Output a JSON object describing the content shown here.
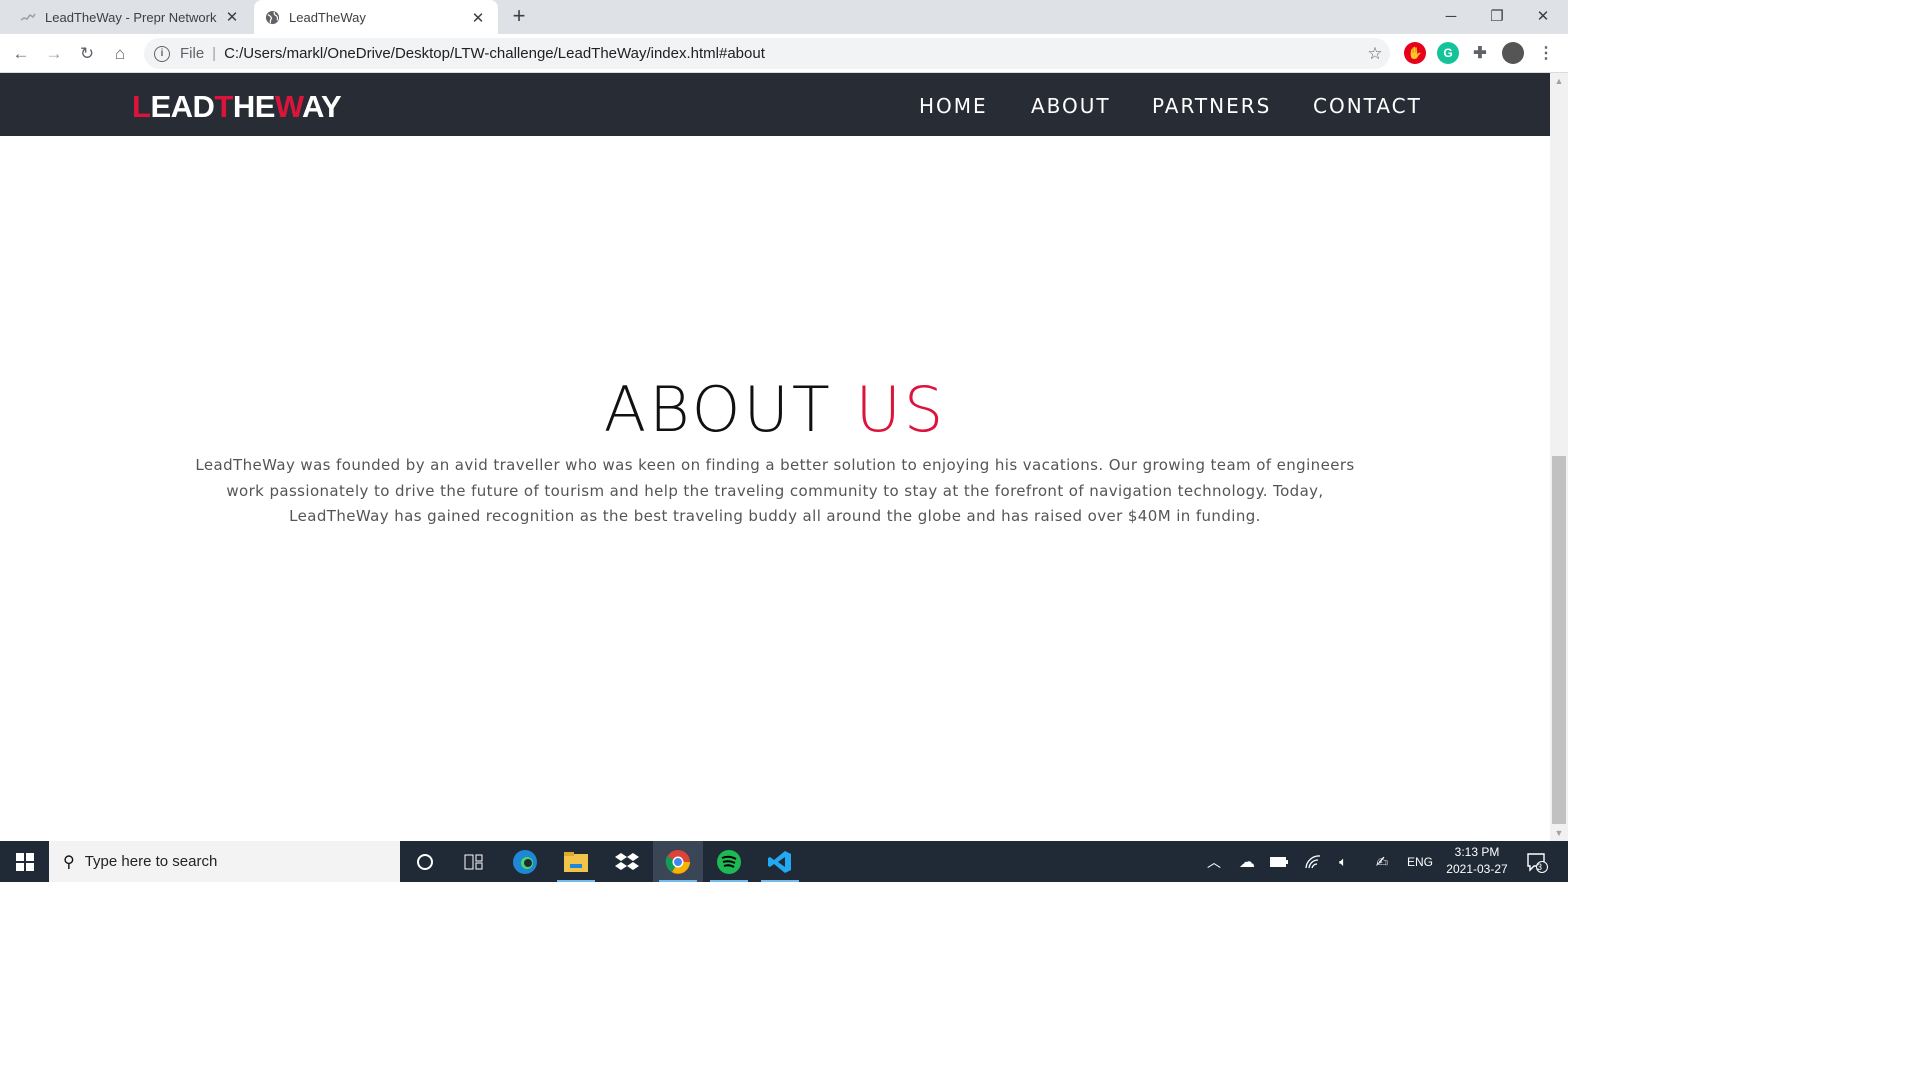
{
  "browser": {
    "tabs": [
      {
        "title": "LeadTheWay - Prepr Network",
        "active": false
      },
      {
        "title": "LeadTheWay",
        "active": true
      }
    ],
    "new_tab": "+",
    "address": {
      "scheme": "File",
      "url": "C:/Users/markl/OneDrive/Desktop/LTW-challenge/LeadTheWay/index.html#about"
    }
  },
  "site": {
    "logo": {
      "l": "L",
      "ead": "EAD",
      "t": "T",
      "he": "HE",
      "w": "W",
      "ay": "AY"
    },
    "nav": [
      "HOME",
      "ABOUT",
      "PARTNERS",
      "CONTACT"
    ],
    "about": {
      "title_main": "ABOUT",
      "title_accent": "US",
      "text": "LeadTheWay was founded by an avid traveller who was keen on finding a better solution to enjoying his vacations. Our growing team of engineers work passionately to drive the future of tourism and help the traveling community to stay at the forefront of navigation technology. Today, LeadTheWay has gained recognition as the best traveling buddy all around the globe and has raised over $40M in funding."
    },
    "accent_color": "#dc143c",
    "nav_bg": "#282c34"
  },
  "taskbar": {
    "search_placeholder": "Type here to search",
    "language": "ENG",
    "time": "3:13 PM",
    "date": "2021-03-27",
    "notifications": "3"
  }
}
